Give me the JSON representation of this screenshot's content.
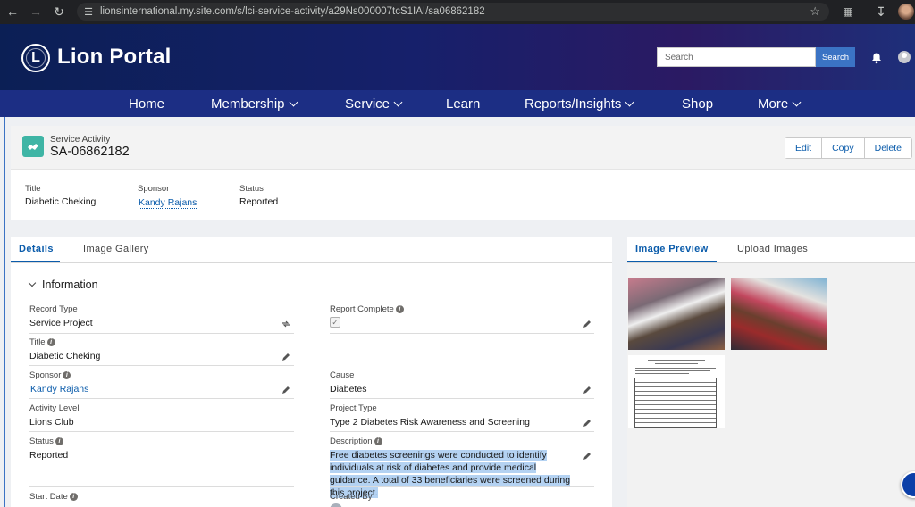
{
  "browser": {
    "url": "lionsinternational.my.site.com/s/lci-service-activity/a29Ns000007tcS1IAI/sa06862182"
  },
  "header": {
    "brand": "Lion Portal",
    "logo_text": "L",
    "search_placeholder": "Search",
    "search_button": "Search"
  },
  "nav": {
    "items": [
      "Home",
      "Membership",
      "Service",
      "Learn",
      "Reports/Insights",
      "Shop",
      "More"
    ]
  },
  "record": {
    "object_label": "Service Activity",
    "name": "SA-06862182",
    "actions": [
      "Edit",
      "Copy",
      "Delete"
    ],
    "highlights": [
      {
        "label": "Title",
        "value": "Diabetic Cheking"
      },
      {
        "label": "Sponsor",
        "value": "Kandy Rajans"
      },
      {
        "label": "Status",
        "value": "Reported"
      }
    ]
  },
  "details": {
    "tabs": [
      "Details",
      "Image Gallery"
    ],
    "section_title": "Information",
    "fields": {
      "record_type": {
        "label": "Record Type",
        "value": "Service Project"
      },
      "report_complete": {
        "label": "Report Complete",
        "checked": true
      },
      "title": {
        "label": "Title",
        "value": "Diabetic Cheking"
      },
      "sponsor": {
        "label": "Sponsor",
        "value": "Kandy Rajans"
      },
      "cause": {
        "label": "Cause",
        "value": "Diabetes"
      },
      "activity_level": {
        "label": "Activity Level",
        "value": "Lions Club"
      },
      "project_type": {
        "label": "Project Type",
        "value": "Type 2 Diabetes Risk Awareness and Screening"
      },
      "status": {
        "label": "Status",
        "value": "Reported"
      },
      "description": {
        "label": "Description",
        "value": "Free diabetes screenings were conducted to identify individuals at risk of diabetes and provide medical guidance. A total of 33 beneficiaries were screened during this project."
      },
      "start_date": {
        "label": "Start Date"
      },
      "created_by": {
        "label": "Created By"
      }
    }
  },
  "images": {
    "tabs": [
      "Image Preview",
      "Upload Images"
    ]
  },
  "colors": {
    "accent": "#0b5cab",
    "nav_bg": "#1c2e84",
    "object_icon": "#3fb5a5"
  }
}
